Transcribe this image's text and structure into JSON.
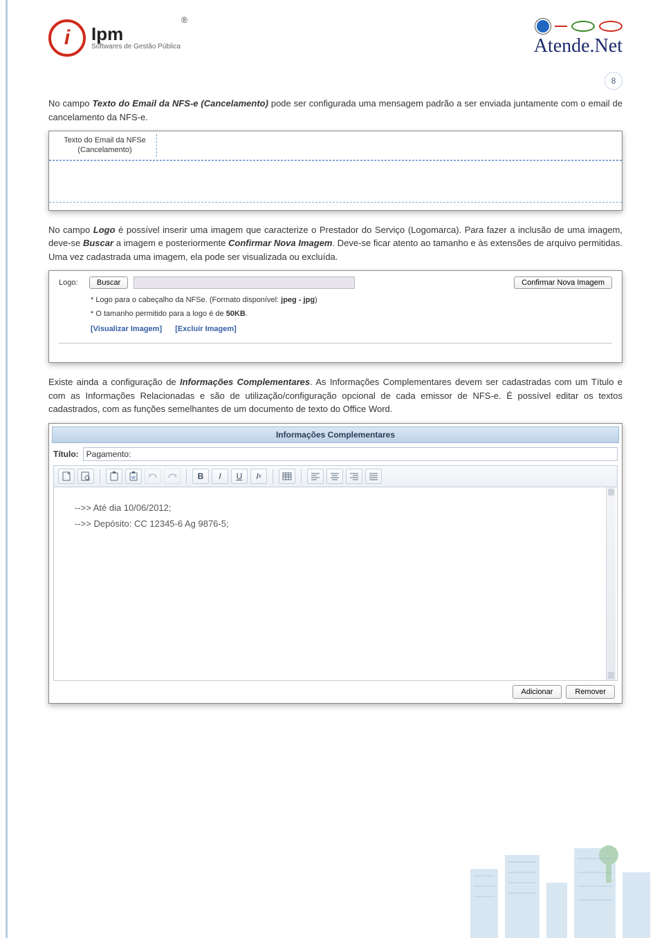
{
  "header": {
    "ipm_brand": "Ipm",
    "ipm_tagline": "Softwares de Gestão Pública",
    "ipm_reg": "®",
    "atende_name": "Atende.Net"
  },
  "page_number": "8",
  "para1": {
    "pre": "No campo ",
    "b1": "Texto do Email da NFS-e (Cancelamento)",
    "post": " pode ser configurada uma mensagem padrão a ser enviada juntamente com o email de cancelamento da NFS-e."
  },
  "panel_textemail": {
    "label_line1": "Texto do Email da NFSe",
    "label_line2": "(Cancelamento)"
  },
  "para2": {
    "pre": "No campo ",
    "b1": "Logo",
    "mid1": " é possível inserir uma imagem que caracterize o Prestador do Serviço (Logomarca). Para fazer a inclusão de uma imagem, deve-se ",
    "b2": "Buscar",
    "mid2": " a imagem e posteriormente ",
    "b3": "Confirmar Nova Imagem",
    "post": ". Deve-se ficar atento ao tamanho e às extensões de arquivo permitidas. Uma vez cadastrada uma imagem, ela pode ser visualizada ou excluída."
  },
  "panel_logo": {
    "label": "Logo:",
    "buscar": "Buscar",
    "confirmar": "Confirmar Nova Imagem",
    "note1_pre": "* Logo para o cabeçalho da NFSe. (Formato disponível: ",
    "note1_bold": "jpeg - jpg",
    "note1_post": ")",
    "note2_pre": "* O tamanho permitido para a logo é de ",
    "note2_bold": "50KB",
    "note2_post": ".",
    "link_visualizar": "[Visualizar Imagem]",
    "link_excluir": "[Excluir Imagem]"
  },
  "para3": {
    "pre": "Existe ainda a configuração de ",
    "b1": "Informações Complementares",
    "post": ". As Informações Complementares devem ser cadastradas com um Título e com as Informações Relacionadas e são de utilização/configuração opcional de cada emissor de NFS-e. É possível editar os textos cadastrados, com as funções semelhantes de um documento de texto do Office Word."
  },
  "panel_ic": {
    "title": "Informações Complementares",
    "titulo_label": "Título:",
    "titulo_value": "Pagamento:",
    "editor_line1": "-->> Até dia 10/06/2012;",
    "editor_line2": "-->> Depósito: CC 12345-6 Ag 9876-5;",
    "btn_adicionar": "Adicionar",
    "btn_remover": "Remover"
  }
}
